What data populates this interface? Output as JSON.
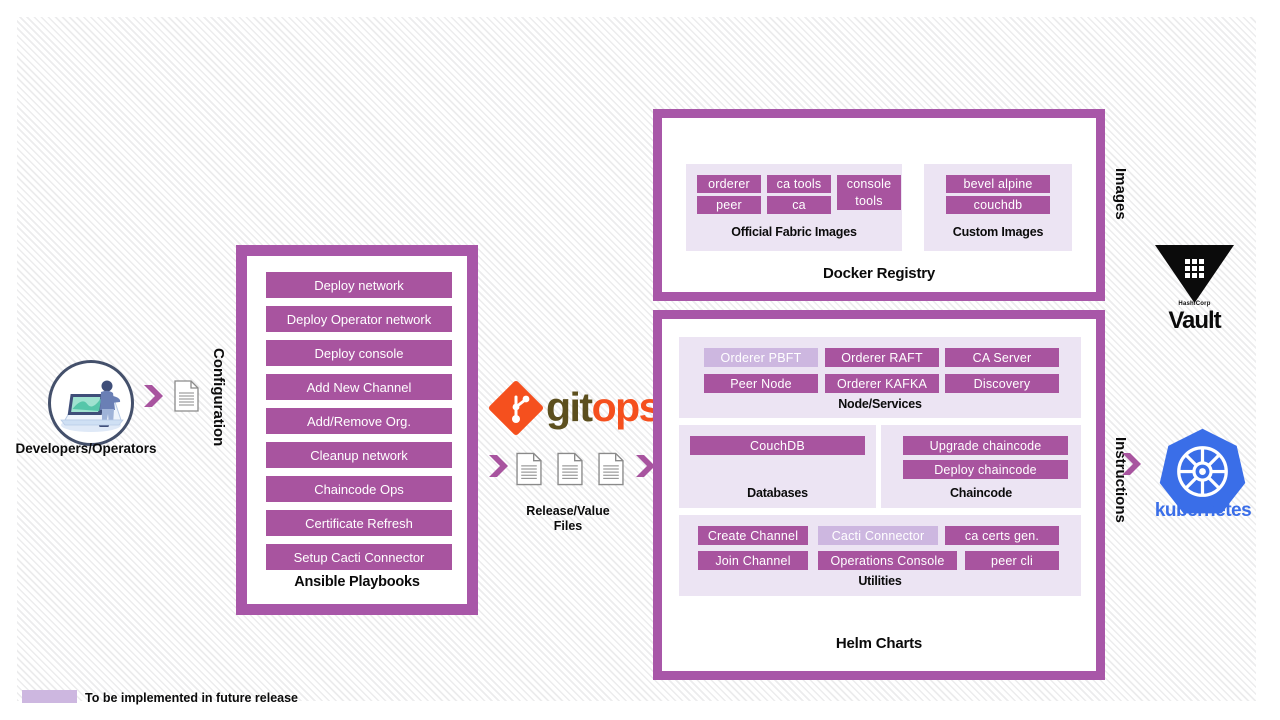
{
  "meta": {
    "colors": {
      "frame_purple": "#a857a8",
      "chip_purple": "#a8549f",
      "chip_future_purple": "#cdb7e0",
      "panel_lavender": "#ece4f3",
      "kubernetes_blue": "#3a6ee8",
      "gitops_orange": "#f5501e",
      "gitops_olive": "#5c4f1e"
    }
  },
  "actors": {
    "developers_label": "Developers/Operators"
  },
  "flow_labels": {
    "configuration": "Configuration",
    "images": "Images",
    "instructions": "Instructions"
  },
  "gitops": {
    "word_part1": "git",
    "word_part2": "ops",
    "files_caption_line1": "Release/Value",
    "files_caption_line2": "Files"
  },
  "ansible": {
    "title": "Ansible Playbooks",
    "playbooks": [
      "Deploy network",
      "Deploy Operator network",
      "Deploy console",
      "Add New Channel",
      "Add/Remove Org.",
      "Cleanup network",
      "Chaincode Ops",
      "Certificate Refresh",
      "Setup Cacti Connector"
    ]
  },
  "docker_registry": {
    "title": "Docker Registry",
    "groups": [
      {
        "title": "Official Fabric Images",
        "rows": [
          [
            "orderer",
            "ca tools",
            "console"
          ],
          [
            "peer",
            "ca",
            "tools"
          ]
        ]
      },
      {
        "title": "Custom Images",
        "rows": [
          [
            "bevel alpine"
          ],
          [
            "couchdb"
          ]
        ]
      }
    ]
  },
  "helm_charts": {
    "title": "Helm Charts",
    "node_services": {
      "title": "Node/Services",
      "chips": [
        {
          "label": "Orderer PBFT",
          "future": true
        },
        {
          "label": "Orderer RAFT",
          "future": false
        },
        {
          "label": "CA Server",
          "future": false
        },
        {
          "label": "Peer Node",
          "future": false
        },
        {
          "label": "Orderer KAFKA",
          "future": false
        },
        {
          "label": "Discovery",
          "future": false
        }
      ]
    },
    "databases": {
      "title": "Databases",
      "chips": [
        {
          "label": "CouchDB",
          "future": false
        }
      ]
    },
    "chaincode": {
      "title": "Chaincode",
      "chips": [
        {
          "label": "Upgrade chaincode",
          "future": false
        },
        {
          "label": "Deploy chaincode",
          "future": false
        }
      ]
    },
    "utilities": {
      "title": "Utilities",
      "chips": [
        {
          "label": "Create Channel",
          "future": false
        },
        {
          "label": "Cacti Connector",
          "future": true
        },
        {
          "label": "ca certs gen.",
          "future": false
        },
        {
          "label": "Join Channel",
          "future": false
        },
        {
          "label": "Operations Console",
          "future": false
        },
        {
          "label": "peer cli",
          "future": false
        }
      ]
    }
  },
  "vault": {
    "brand": "HashiCorp",
    "name": "Vault"
  },
  "kubernetes": {
    "name": "kubernetes"
  },
  "legend": {
    "text": "To be implemented in future release"
  }
}
